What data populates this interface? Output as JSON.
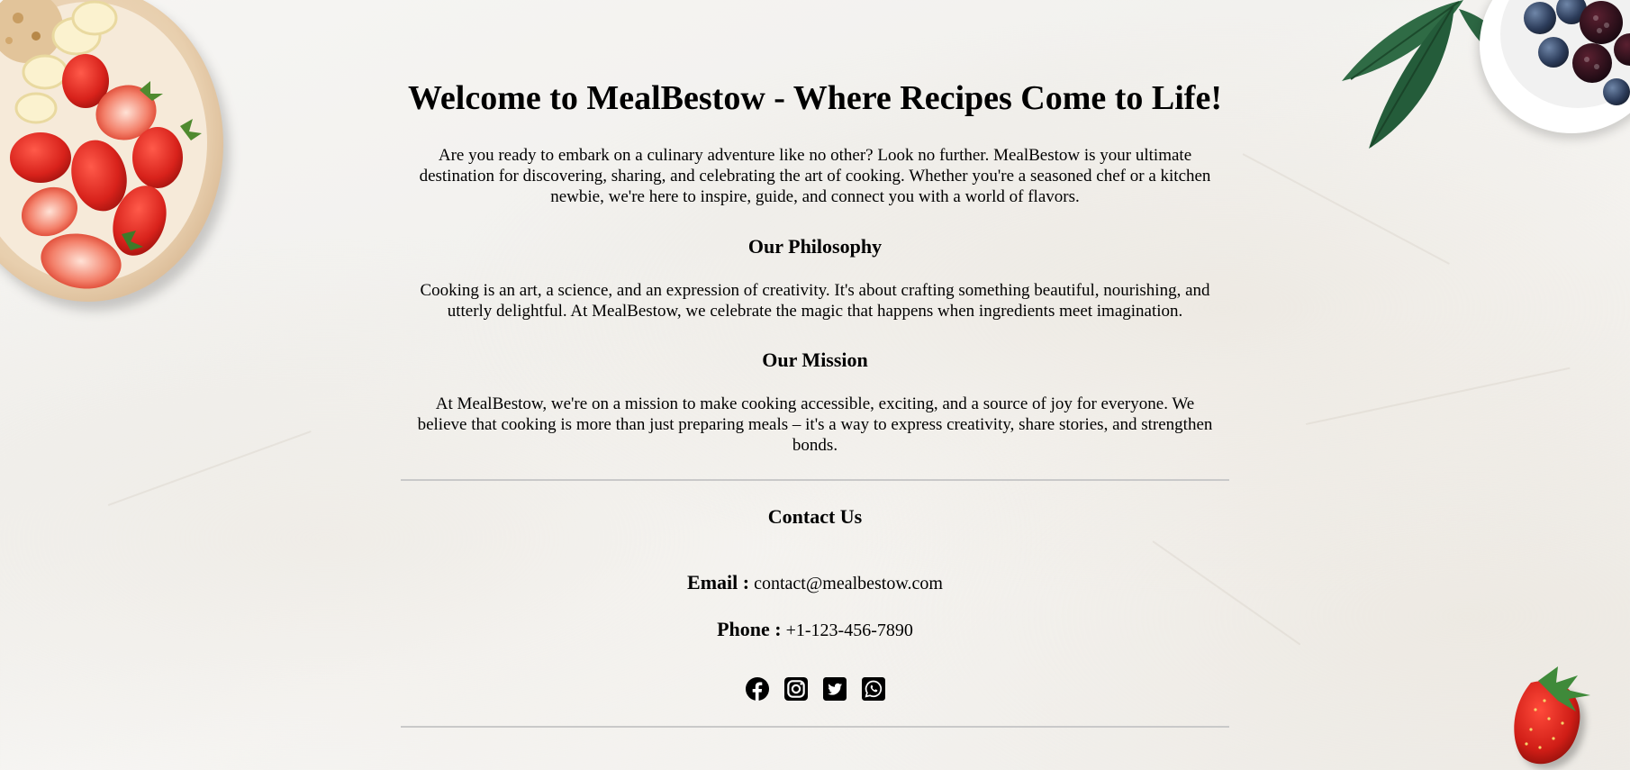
{
  "welcome": {
    "title": "Welcome to MealBestow - Where Recipes Come to Life!",
    "intro": "Are you ready to embark on a culinary adventure like no other? Look no further. MealBestow is your ultimate destination for discovering, sharing, and celebrating the art of cooking. Whether you're a seasoned chef or a kitchen newbie, we're here to inspire, guide, and connect you with a world of flavors."
  },
  "philosophy": {
    "heading": "Our Philosophy",
    "text": "Cooking is an art, a science, and an expression of creativity. It's about crafting something beautiful, nourishing, and utterly delightful. At MealBestow, we celebrate the magic that happens when ingredients meet imagination."
  },
  "mission": {
    "heading": "Our Mission",
    "text": "At MealBestow, we're on a mission to make cooking accessible, exciting, and a source of joy for everyone. We believe that cooking is more than just preparing meals – it's a way to express creativity, share stories, and strengthen bonds."
  },
  "contact": {
    "title": "Contact Us",
    "email_label": "Email :",
    "email_value": "contact@mealbestow.com",
    "phone_label": "Phone :",
    "phone_value": "+1-123-456-7890",
    "socials": [
      {
        "icon": "facebook-icon"
      },
      {
        "icon": "instagram-icon"
      },
      {
        "icon": "twitter-icon"
      },
      {
        "icon": "whatsapp-icon"
      }
    ]
  },
  "decorations": {
    "top_left": "fruit-bowl-image",
    "top_right": "berries-leaves-image",
    "bottom_right": "strawberry-image"
  },
  "colors": {
    "background": "#f4f3f0",
    "text": "#000000",
    "divider": "#c9c9c9"
  }
}
